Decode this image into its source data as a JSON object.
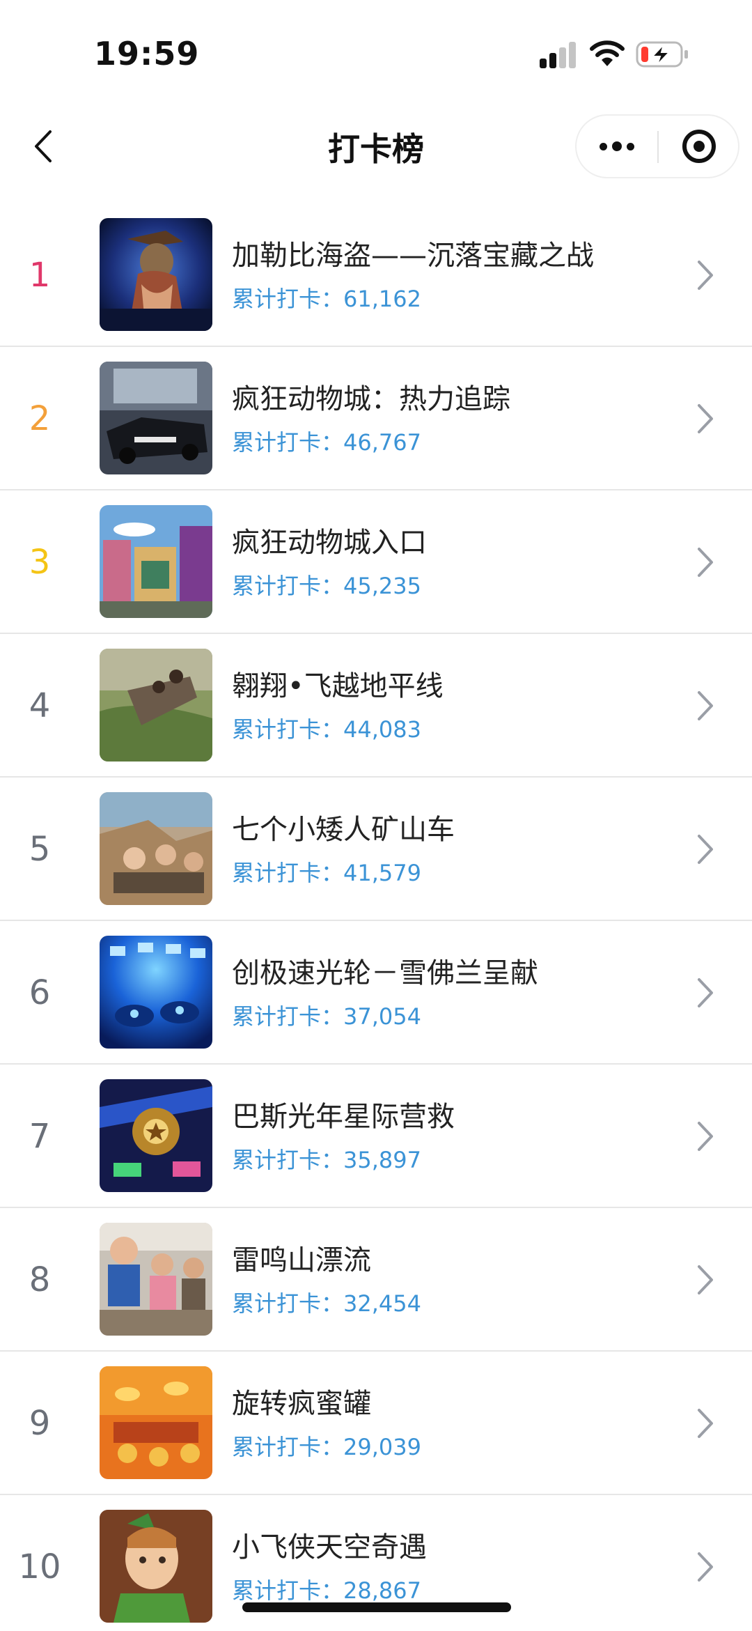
{
  "status_bar": {
    "time": "19:59"
  },
  "nav": {
    "title": "打卡榜"
  },
  "rank_colors": {
    "1": "#e0386a",
    "2": "#f3a03a",
    "3": "#f4c415",
    "default": "#6a6f78"
  },
  "count_color": "#3b93d6",
  "items": [
    {
      "rank": "1",
      "name": "加勒比海盗——沉落宝藏之战",
      "count": "累计打卡：61,162",
      "thumb": "pirate-captain-ride-photo"
    },
    {
      "rank": "2",
      "name": "疯狂动物城：热力追踪",
      "count": "累计打卡：46,767",
      "thumb": "police-car-ride-photo"
    },
    {
      "rank": "3",
      "name": "疯狂动物城入口",
      "count": "累计打卡：45,235",
      "thumb": "zootopia-entrance-photo"
    },
    {
      "rank": "4",
      "name": "翱翔•飞越地平线",
      "count": "累计打卡：44,083",
      "thumb": "soaring-ride-photo"
    },
    {
      "rank": "5",
      "name": "七个小矮人矿山车",
      "count": "累计打卡：41,579",
      "thumb": "mine-train-photo"
    },
    {
      "rank": "6",
      "name": "创极速光轮－雪佛兰呈献",
      "count": "累计打卡：37,054",
      "thumb": "tron-lightcycle-photo"
    },
    {
      "rank": "7",
      "name": "巴斯光年星际营救",
      "count": "累计打卡：35,897",
      "thumb": "buzz-lightyear-photo"
    },
    {
      "rank": "8",
      "name": "雷鸣山漂流",
      "count": "累计打卡：32,454",
      "thumb": "roaring-rapids-photo"
    },
    {
      "rank": "9",
      "name": "旋转疯蜜罐",
      "count": "累计打卡：29,039",
      "thumb": "hunny-pot-spin-photo"
    },
    {
      "rank": "10",
      "name": "小飞侠天空奇遇",
      "count": "累计打卡：28,867",
      "thumb": "peter-pan-flight-photo"
    }
  ]
}
